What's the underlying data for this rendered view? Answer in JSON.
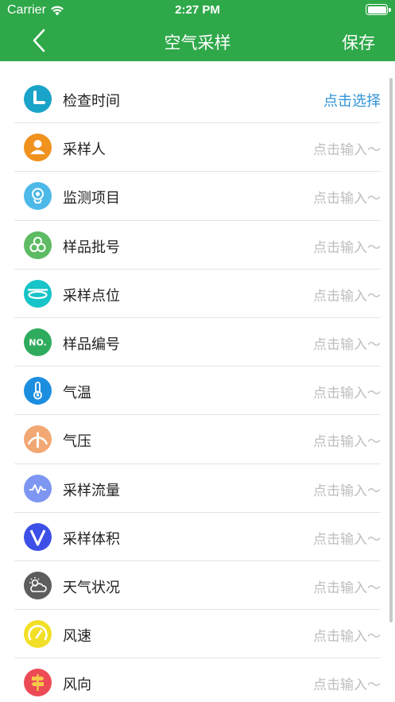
{
  "status": {
    "carrier": "Carrier",
    "time": "2:27 PM"
  },
  "nav": {
    "title": "空气采样",
    "save_label": "保存"
  },
  "rows": [
    {
      "label": "检查时间",
      "value": "点击选择",
      "icon": "clock-icon",
      "color": "#1aa3c9"
    },
    {
      "label": "采样人",
      "value": "点击输入～",
      "icon": "person-icon",
      "color": "#f0921e"
    },
    {
      "label": "监测项目",
      "value": "点击输入～",
      "icon": "monitor-icon",
      "color": "#4cb9e8"
    },
    {
      "label": "样品批号",
      "value": "点击输入～",
      "icon": "batch-icon",
      "color": "#5dbb63"
    },
    {
      "label": "采样点位",
      "value": "点击输入～",
      "icon": "ring-icon",
      "color": "#17c4c8"
    },
    {
      "label": "样品编号",
      "value": "点击输入～",
      "icon": "number-icon",
      "color": "#2eab5d"
    },
    {
      "label": "气温",
      "value": "点击输入～",
      "icon": "thermometer-icon",
      "color": "#1c8ee0"
    },
    {
      "label": "气压",
      "value": "点击输入～",
      "icon": "gauge-icon",
      "color": "#f2a874"
    },
    {
      "label": "采样流量",
      "value": "点击输入～",
      "icon": "pulse-icon",
      "color": "#7d96f2"
    },
    {
      "label": "采样体积",
      "value": "点击输入～",
      "icon": "v-icon",
      "color": "#3c4fe6"
    },
    {
      "label": "天气状况",
      "value": "点击输入～",
      "icon": "weather-icon",
      "color": "#5d5d5d"
    },
    {
      "label": "风速",
      "value": "点击输入～",
      "icon": "speedometer-icon",
      "color": "#f2df28"
    },
    {
      "label": "风向",
      "value": "点击输入～",
      "icon": "signpost-icon",
      "color": "#ec4b56"
    }
  ],
  "colors": {
    "header": "#2fa84a",
    "accent": "#2f93d8",
    "placeholder": "#bdbdbd"
  }
}
